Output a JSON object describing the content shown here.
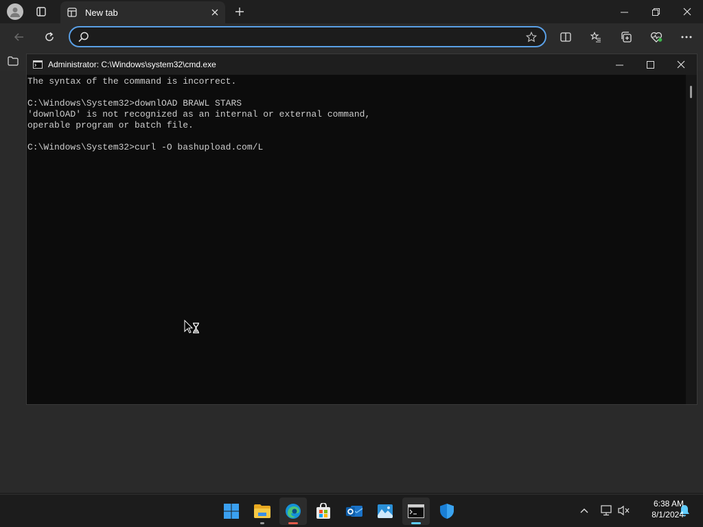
{
  "browser": {
    "tab_title": "New tab",
    "address_placeholder": ""
  },
  "cmd": {
    "title": "Administrator: C:\\Windows\\system32\\cmd.exe",
    "lines": [
      "The syntax of the command is incorrect.",
      "",
      "C:\\Windows\\System32>downlOAD BRAWL STARS",
      "'downlOAD' is not recognized as an internal or external command,",
      "operable program or batch file.",
      "",
      "C:\\Windows\\System32>curl -O bashupload.com/L"
    ]
  },
  "taskbar": {
    "time": "6:38 AM",
    "date": "8/1/2024"
  },
  "colors": {
    "accent": "#60cdff",
    "address_border": "#5aa0e6",
    "terminal_bg": "#0c0c0c",
    "terminal_fg": "#cccccc"
  }
}
